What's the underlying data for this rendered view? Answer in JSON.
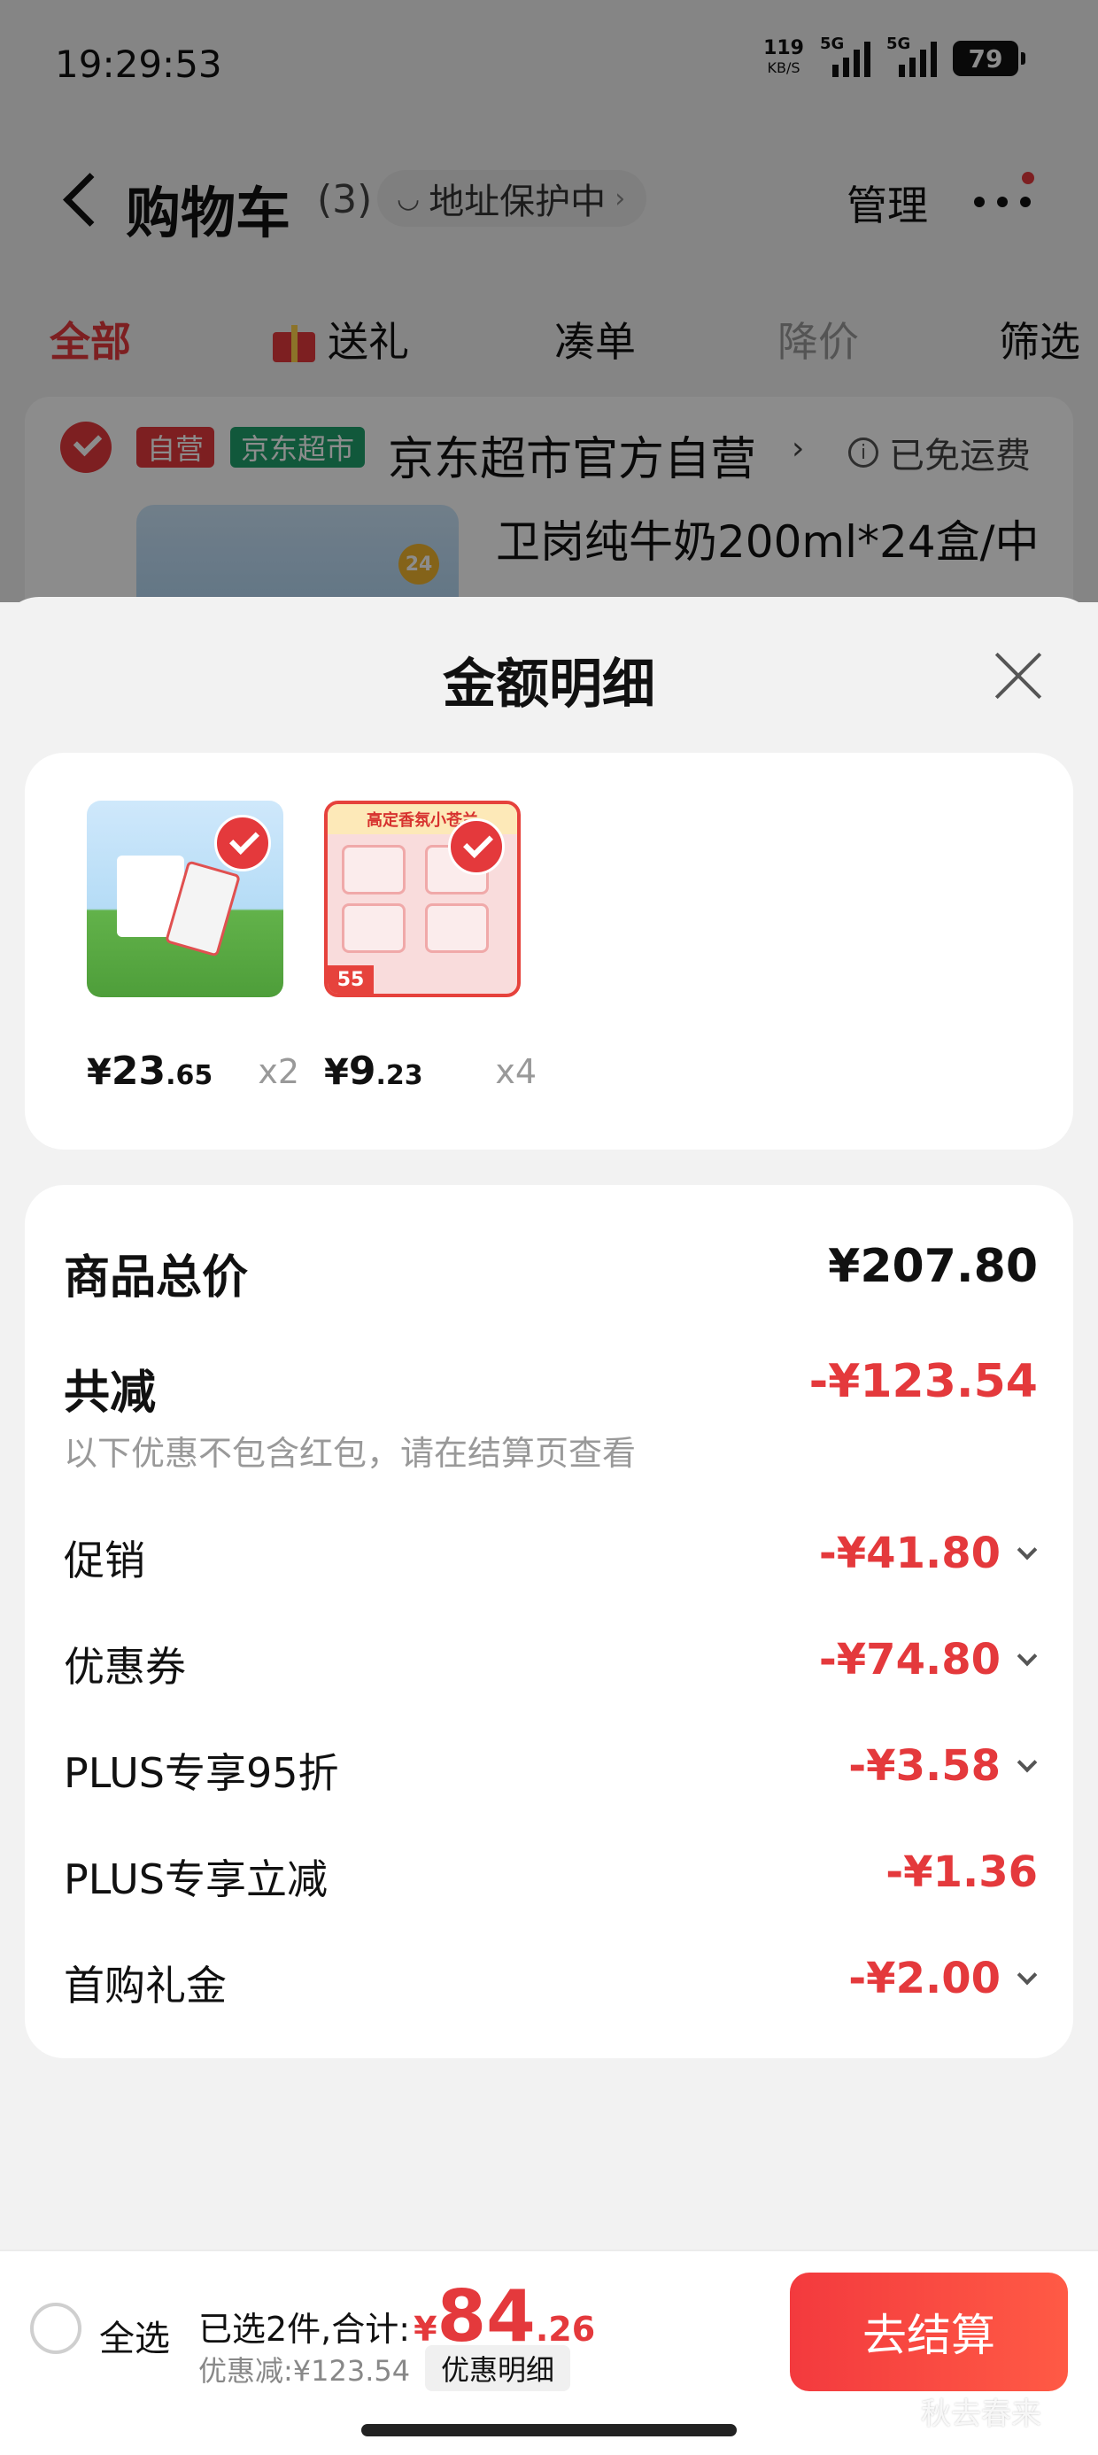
{
  "status_bar": {
    "time": "19:29:53",
    "net_speed": "119",
    "net_unit": "KB/S",
    "sig1_label": "5G",
    "sig2_label": "5G",
    "battery": "79"
  },
  "header": {
    "title": "购物车",
    "count": "(3)",
    "address_protect": "地址保护中",
    "manage": "管理"
  },
  "cart_tabs": [
    {
      "label": "全部"
    },
    {
      "label": "送礼"
    },
    {
      "label": "凑单"
    },
    {
      "label": "降价"
    },
    {
      "label": "筛选"
    }
  ],
  "store": {
    "tag_self": "自营",
    "tag_jd": "京东超市",
    "name": "京东超市官方自营",
    "free_shipping": "已免运费",
    "badge": "24",
    "product_title": "卫岗纯牛奶200ml*24盒/中"
  },
  "sheet": {
    "title": "金额明细",
    "items": [
      {
        "yen": "¥",
        "int": "23",
        "dec": ".65",
        "qty": "x2",
        "img": "milk-product"
      },
      {
        "yen": "¥",
        "int": "9",
        "dec": ".23",
        "qty": "x4",
        "img": "tissue-product",
        "img_header": "高定香氛小苍兰",
        "img_tag": "55"
      }
    ],
    "summary": {
      "goods_total_label": "商品总价",
      "goods_total_value": "¥207.80",
      "total_reduce_label": "共减",
      "total_reduce_value": "-¥123.54",
      "note": "以下优惠不包含红包，请在结算页查看",
      "rows": [
        {
          "label": "促销",
          "value": "-¥41.80"
        },
        {
          "label": "优惠券",
          "value": "-¥74.80"
        },
        {
          "label": "PLUS专享95折",
          "value": "-¥3.58"
        },
        {
          "label": "PLUS专享立减",
          "value": "-¥1.36"
        },
        {
          "label": "首购礼金",
          "value": "-¥2.00"
        }
      ]
    }
  },
  "bottom_bar": {
    "select_all": "全选",
    "selected": "已选2件,合计:",
    "total_yen": "¥",
    "total_int": "84",
    "total_dec": ".26",
    "discount": "优惠减:¥123.54",
    "detail_button": "优惠明细",
    "checkout": "去结算"
  },
  "watermark": "秋去春来",
  "colors": {
    "accent": "#e4393c",
    "jd_green": "#1fa06c"
  }
}
